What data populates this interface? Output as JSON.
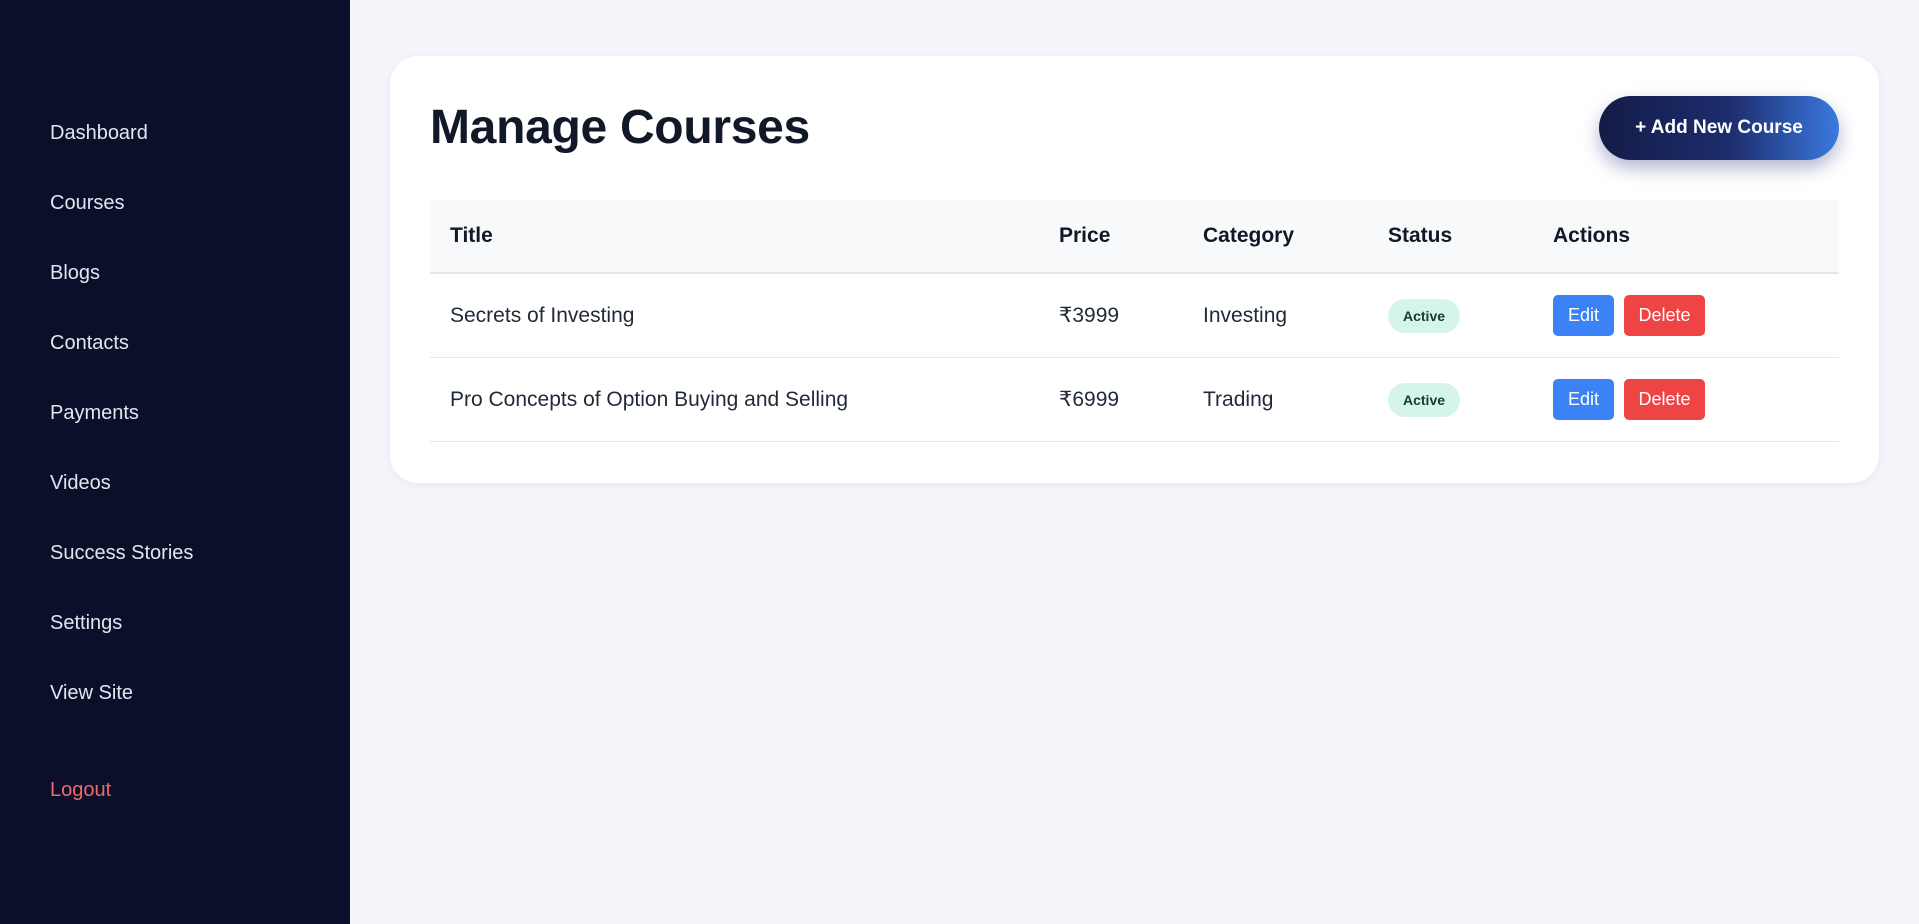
{
  "sidebar": {
    "items": [
      {
        "label": "Dashboard"
      },
      {
        "label": "Courses"
      },
      {
        "label": "Blogs"
      },
      {
        "label": "Contacts"
      },
      {
        "label": "Payments"
      },
      {
        "label": "Videos"
      },
      {
        "label": "Success Stories"
      },
      {
        "label": "Settings"
      },
      {
        "label": "View Site"
      }
    ],
    "logout_label": "Logout"
  },
  "main": {
    "title": "Manage Courses",
    "add_button_label": "+ Add New Course",
    "table": {
      "headers": {
        "title": "Title",
        "price": "Price",
        "category": "Category",
        "status": "Status",
        "actions": "Actions"
      },
      "rows": [
        {
          "title": "Secrets of Investing",
          "price": "₹3999",
          "category": "Investing",
          "status": "Active",
          "edit_label": "Edit",
          "delete_label": "Delete"
        },
        {
          "title": "Pro Concepts of Option Buying and Selling",
          "price": "₹6999",
          "category": "Trading",
          "status": "Active",
          "edit_label": "Edit",
          "delete_label": "Delete"
        }
      ]
    }
  },
  "colors": {
    "sidebar_bg": "#0b0f2a",
    "logout": "#f06a6a",
    "edit": "#3b82f6",
    "delete": "#ef4444",
    "status_active_bg": "#d5f5e8"
  }
}
